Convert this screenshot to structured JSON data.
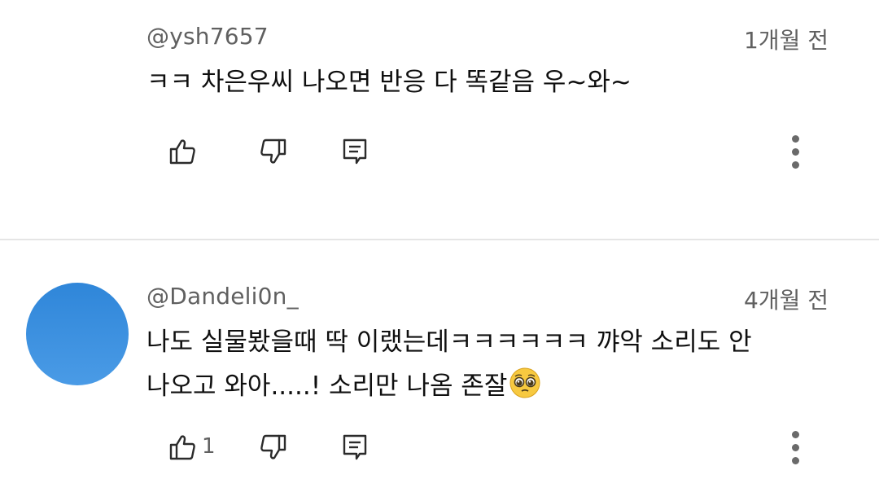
{
  "comments": [
    {
      "author": "@ysh7657",
      "time": "1개월 전",
      "text": "ㅋㅋ 차은우씨 나오면 반응 다 똑같음 우~와~",
      "like_count": ""
    },
    {
      "author": "@Dandeli0n_",
      "time": "4개월 전",
      "text_line1": "나도 실물봤을때 딱 이랬는데ㅋㅋㅋㅋㅋㅋ 꺄악 소리도 안",
      "text_line2": "나오고 와아.....! 소리만 나옴 존잘",
      "like_count": "1",
      "avatar_color": "#3a8fdf"
    }
  ],
  "icons": {
    "like": "thumb-up-icon",
    "dislike": "thumb-down-icon",
    "reply": "reply-icon",
    "more": "more-vert-icon",
    "emoji": "pleading-face-emoji"
  }
}
